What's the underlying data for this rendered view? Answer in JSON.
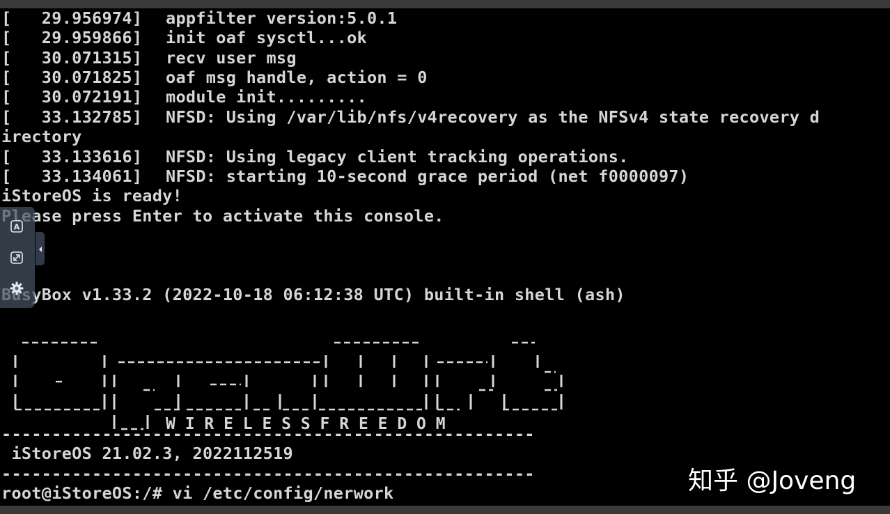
{
  "colors": {
    "terminal_bg": "#000000",
    "terminal_fg": "#d6d6d6",
    "frame": "#3a3a3a",
    "toolbar_bg": "#46506490",
    "watermark": "#ffffff"
  },
  "terminal": {
    "log_lines": [
      {
        "ts": "[   29.956974]",
        "msg": "appfilter version:5.0.1"
      },
      {
        "ts": "[   29.959866]",
        "msg": "init oaf sysctl...ok"
      },
      {
        "ts": "[   30.071315]",
        "msg": "recv user msg"
      },
      {
        "ts": "[   30.071825]",
        "msg": "oaf msg handle, action = 0"
      },
      {
        "ts": "[   30.072191]",
        "msg": "module init........."
      },
      {
        "ts": "[   33.132785]",
        "msg": "NFSD: Using /var/lib/nfs/v4recovery as the NFSv4 state recovery d"
      }
    ],
    "wrap_line": "irectory",
    "log_lines_2": [
      {
        "ts": "[   33.133616]",
        "msg": "NFSD: Using legacy client tracking operations."
      },
      {
        "ts": "[   33.134061]",
        "msg": "NFSD: starting 10-second grace period (net f0000097)"
      }
    ],
    "ready_line": "iStoreOS is ready!",
    "press_enter_line": "Please press Enter to activate this console.",
    "busybox_line": "BusyBox v1.33.2 (2022-10-18 06:12:38 UTC) built-in shell (ash)",
    "banner_tagline": "W I R E L E S S   F R E E D O M",
    "dash_line": "-----------------------------------------------------",
    "version_line": " iStoreOS 21.02.3, 2022112519",
    "prompt": "root@iStoreOS:/# ",
    "command": "vi /etc/config/nerwork"
  },
  "watermark": {
    "text": "知乎 @Joveng"
  },
  "toolbar": {
    "buttons": [
      {
        "icon": "keyboard-a-icon"
      },
      {
        "icon": "fullscreen-icon"
      },
      {
        "icon": "gear-icon"
      }
    ],
    "handle_icon": "chevron-left-icon"
  }
}
